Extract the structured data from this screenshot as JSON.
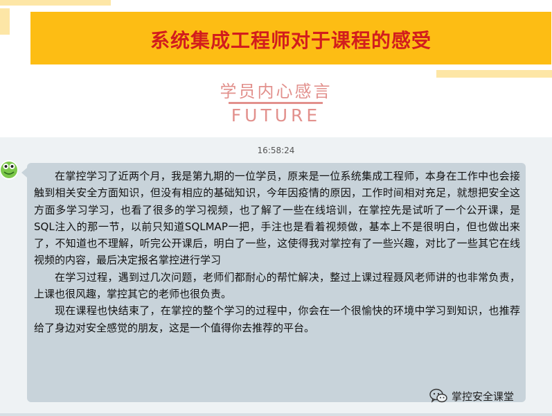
{
  "header": {
    "title": "系统集成工程师对于课程的感受",
    "subtitle": "学员内心感言",
    "subtitle_en": "FUTURE"
  },
  "chat": {
    "timestamp": "16:58:24",
    "paragraphs": [
      "在掌控学习了近两个月，我是第九期的一位学员，原来是一位系统集成工程师，本身在工作中也会接触到相关安全方面知识，但没有相应的基础知识，今年因疫情的原因，工作时间相对充足，就想把安全这方面多学习学习，也看了很多的学习视频，也了解了一些在线培训，在掌控先是试听了一个公开课，是SQL注入的那一节，以前只知道SQLMAP一把，手注也是看着视频做，基本上不是很明白，但也做出来了，不知道也不理解，听完公开课后，明白了一些，这使得我对掌控有了一些兴趣，对比了一些其它在线视频的内容，最后决定报名掌控进行学习",
      "在学习过程，遇到过几次问题，老师们都耐心的帮忙解决，整过上课过程聂风老师讲的也非常负责，上课也很风趣，掌控其它的老师也很负责。",
      "现在课程也快结束了，在掌控的整个学习的过程中，你会在一个很愉快的环境中学习到知识，也推荐给了身边对安全感觉的朋友，这是一个值得你去推荐的平台。"
    ]
  },
  "watermark": {
    "icon": "wechat-icon",
    "text": "掌控安全课堂"
  },
  "colors": {
    "banner": "#fdbd14",
    "title": "#d21d1d",
    "accent": "#e2908c",
    "bubble": "#c8d3da"
  }
}
